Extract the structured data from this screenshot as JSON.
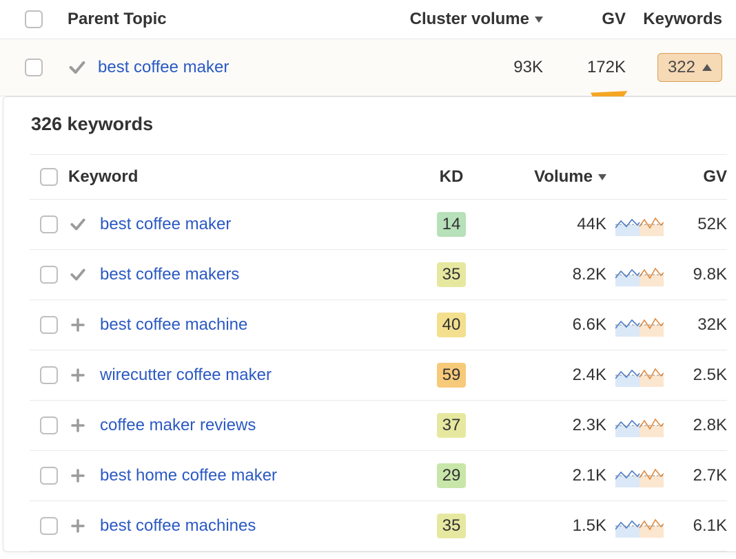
{
  "parent_table": {
    "headers": {
      "parent_topic": "Parent Topic",
      "cluster_volume": "Cluster volume",
      "gv": "GV",
      "keywords": "Keywords"
    },
    "row": {
      "topic": "best coffee maker",
      "cluster_volume": "93K",
      "gv": "172K",
      "keyword_count": "322"
    }
  },
  "panel": {
    "title": "326 keywords",
    "headers": {
      "keyword": "Keyword",
      "kd": "KD",
      "volume": "Volume",
      "gv": "GV"
    },
    "rows": [
      {
        "name": "best coffee maker",
        "kd": "14",
        "kd_color": "#b7e1b9",
        "volume": "44K",
        "gv": "52K",
        "state": "check"
      },
      {
        "name": "best coffee makers",
        "kd": "35",
        "kd_color": "#e6e8a0",
        "volume": "8.2K",
        "gv": "9.8K",
        "state": "check"
      },
      {
        "name": "best coffee machine",
        "kd": "40",
        "kd_color": "#f3df8e",
        "volume": "6.6K",
        "gv": "32K",
        "state": "plus"
      },
      {
        "name": "wirecutter coffee maker",
        "kd": "59",
        "kd_color": "#f7ca7a",
        "volume": "2.4K",
        "gv": "2.5K",
        "state": "plus"
      },
      {
        "name": "coffee maker reviews",
        "kd": "37",
        "kd_color": "#e6e8a0",
        "volume": "2.3K",
        "gv": "2.8K",
        "state": "plus"
      },
      {
        "name": "best home coffee maker",
        "kd": "29",
        "kd_color": "#c9e6aa",
        "volume": "2.1K",
        "gv": "2.7K",
        "state": "plus"
      },
      {
        "name": "best coffee machines",
        "kd": "35",
        "kd_color": "#e6e8a0",
        "volume": "1.5K",
        "gv": "6.1K",
        "state": "plus"
      }
    ]
  }
}
